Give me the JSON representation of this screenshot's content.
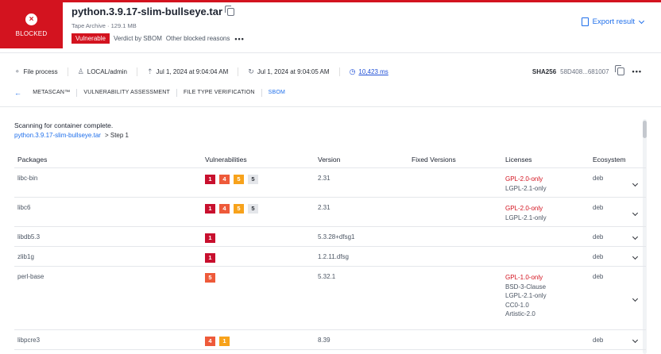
{
  "header": {
    "status_label": "BLOCKED",
    "status_icon": "x-circle-icon",
    "file_name": "python.3.9.17-slim-bullseye.tar",
    "file_meta": "Tape Archive · 129.1 MB",
    "vulnerable_badge": "Vulnerable",
    "verdict_text": "Verdict by SBOM",
    "other_reasons": "Other blocked reasons",
    "more": "•••",
    "export_label": "Export result"
  },
  "info_bar": {
    "process": "File process",
    "user": "LOCAL/admin",
    "upload_time": "Jul 1, 2024 at 9:04:04 AM",
    "finish_time": "Jul 1, 2024 at 9:04:05 AM",
    "duration": "10,423 ms",
    "sha_label": "SHA256",
    "sha_value": "58D408...681007",
    "more": "•••"
  },
  "tabs": [
    {
      "label": "METASCAN™"
    },
    {
      "label": "VULNERABILITY ASSESSMENT"
    },
    {
      "label": "FILE TYPE VERIFICATION"
    },
    {
      "label": "SBOM"
    }
  ],
  "scan": {
    "status": "Scanning for container complete.",
    "crumb_link": "python.3.9.17-slim-bullseye.tar",
    "crumb_step": "Step 1"
  },
  "table": {
    "headers": {
      "packages": "Packages",
      "vulnerabilities": "Vulnerabilities",
      "version": "Version",
      "fixed": "Fixed Versions",
      "licenses": "Licenses",
      "ecosystem": "Ecosystem"
    },
    "rows": [
      {
        "package": "libc-bin",
        "sev": [
          {
            "level": "crit",
            "n": "1"
          },
          {
            "level": "high",
            "n": "4"
          },
          {
            "level": "med",
            "n": "5"
          },
          {
            "level": "low",
            "n": "5"
          }
        ],
        "version": "2.31",
        "fixed": "",
        "licenses": [
          "GPL-2.0-only",
          "LGPL-2.1-only"
        ],
        "ecosystem": "deb"
      },
      {
        "package": "libc6",
        "sev": [
          {
            "level": "crit",
            "n": "1"
          },
          {
            "level": "high",
            "n": "4"
          },
          {
            "level": "med",
            "n": "5"
          },
          {
            "level": "low",
            "n": "5"
          }
        ],
        "version": "2.31",
        "fixed": "",
        "licenses": [
          "GPL-2.0-only",
          "LGPL-2.1-only"
        ],
        "ecosystem": "deb"
      },
      {
        "package": "libdb5.3",
        "sev": [
          {
            "level": "crit",
            "n": "1"
          }
        ],
        "version": "5.3.28+dfsg1",
        "fixed": "",
        "licenses": [],
        "ecosystem": "deb"
      },
      {
        "package": "zlib1g",
        "sev": [
          {
            "level": "crit",
            "n": "1"
          }
        ],
        "version": "1.2.11.dfsg",
        "fixed": "",
        "licenses": [],
        "ecosystem": "deb"
      },
      {
        "package": "perl-base",
        "sev": [
          {
            "level": "high",
            "n": "5"
          }
        ],
        "version": "5.32.1",
        "fixed": "",
        "licenses": [
          "GPL-1.0-only",
          "BSD-3-Clause",
          "LGPL-2.1-only",
          "CC0-1.0",
          "Artistic-2.0"
        ],
        "ecosystem": "deb"
      },
      {
        "package": "libpcre3",
        "sev": [
          {
            "level": "high",
            "n": "4"
          },
          {
            "level": "med",
            "n": "1"
          }
        ],
        "version": "8.39",
        "fixed": "",
        "licenses": [],
        "ecosystem": "deb"
      }
    ]
  },
  "colors": {
    "brand_red": "#d3131f",
    "link_blue": "#1f6feb",
    "sev_critical": "#c8102e",
    "sev_high": "#ee5a3a",
    "sev_medium": "#f7a21b",
    "sev_low": "#e4e6ea"
  }
}
